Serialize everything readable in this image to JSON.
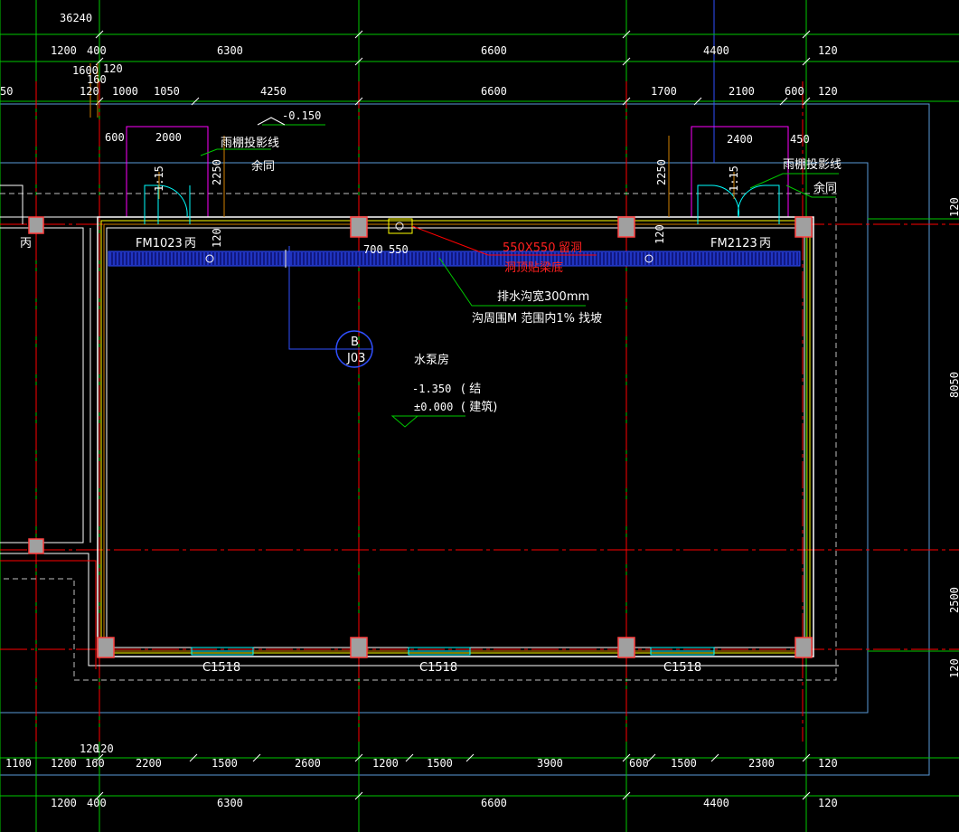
{
  "top_dims": {
    "overall": "36240",
    "row1": [
      "1200",
      "400",
      "6300",
      "6600",
      "4400",
      "120"
    ],
    "row2a": [
      "1600",
      "120",
      "160"
    ],
    "row3": [
      "50",
      "120",
      "1000",
      "1050",
      "4250",
      "6600",
      "1700",
      "2100",
      "600",
      "120"
    ],
    "door_left": [
      "600",
      "2000"
    ],
    "door_right": [
      "2400",
      "450"
    ]
  },
  "labels": {
    "elev_top": "-0.150",
    "canopy_left": "雨棚投影线",
    "canopy_left_same": "余同",
    "canopy_right": "雨棚投影线",
    "canopy_right_same": "余同",
    "v2250_left": "2250",
    "v2250_right": "2250",
    "v115_left": "1:15",
    "v115_right": "1:15",
    "v120_left": "120",
    "v120_right": "120",
    "door_fm1023": "FM1023",
    "bing1": "丙",
    "bing2": "丙",
    "bing3": "丙",
    "door_fm2123": "FM2123",
    "d700": "700",
    "d550": "550",
    "hole_size": "550X550",
    "hole_note": "留洞",
    "hole_bottom": "洞顶贴梁底",
    "trench1": "排水沟宽300mm",
    "trench2": "沟周围M 范围内1% 找坡",
    "callout_top": "B",
    "callout_bottom": "J03",
    "room_name": "水泵房",
    "elev_struct": "-1.350",
    "elev_struct_note": "( 结",
    "elev_arch": "±0.000",
    "elev_arch_note": "( 建筑)",
    "win1": "C1518",
    "win2": "C1518",
    "win3": "C1518",
    "side_r1": "120",
    "side_r2": "8050",
    "side_r3": "2500",
    "side_r4": "120"
  },
  "bottom_dims": {
    "row1": [
      "1100",
      "1200",
      "120",
      "120",
      "160",
      "2200",
      "1500",
      "2600",
      "1200",
      "1500",
      "3900",
      "600",
      "1500",
      "2300",
      "120"
    ],
    "row2": [
      "1200",
      "400",
      "6300",
      "6600",
      "4400",
      "120"
    ]
  },
  "colors": {
    "grid_green": "#00c800",
    "axis_red": "#ff0000",
    "wall_yellow": "#ffff00",
    "blue": "#3050ff",
    "magenta": "#ff00ff",
    "cyan": "#00ffff",
    "orange": "#d08000",
    "column": "#a0a0a0"
  }
}
